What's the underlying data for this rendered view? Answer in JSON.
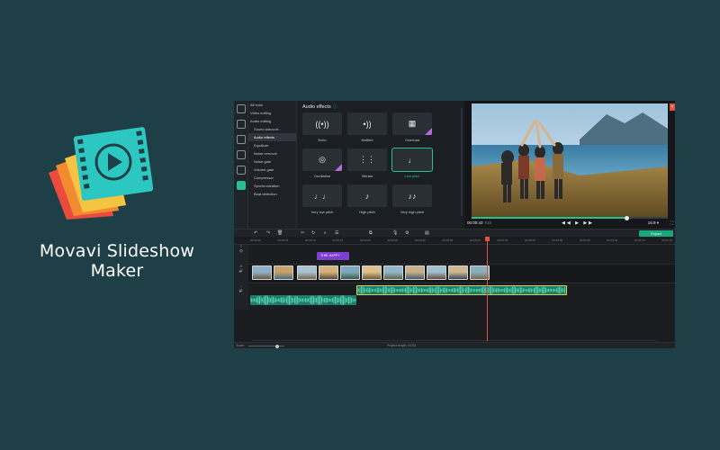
{
  "brand": {
    "title": "Movavi Slideshow Maker",
    "logo_icon": "movavi-slideshow-logo-icon"
  },
  "sidebar_tools": [
    "import-icon",
    "magic-wand-icon",
    "filters-icon",
    "titles-icon",
    "transitions-icon",
    "more-tools-icon"
  ],
  "categories": [
    {
      "label": "All tools",
      "type": "head"
    },
    {
      "label": "Video editing",
      "type": "head"
    },
    {
      "label": "Audio editing",
      "type": "head"
    },
    {
      "label": "Sound autocorr...",
      "type": "item"
    },
    {
      "label": "Audio effects",
      "type": "item",
      "active": true
    },
    {
      "label": "Equalizer",
      "type": "item"
    },
    {
      "label": "Noise removal",
      "type": "item"
    },
    {
      "label": "Noise gate",
      "type": "item"
    },
    {
      "label": "Volume gate",
      "type": "item"
    },
    {
      "label": "Compressor",
      "type": "item"
    },
    {
      "label": "Synchronization",
      "type": "item"
    },
    {
      "label": "Beat detection",
      "type": "item"
    }
  ],
  "effects_panel": {
    "title": "Audio effects",
    "effects": [
      {
        "label": "Echo",
        "icon": "echo-icon",
        "glyph": "((•))",
        "premium": false,
        "selected": false
      },
      {
        "label": "Muffled",
        "icon": "muffled-icon",
        "glyph": "•))",
        "premium": false,
        "selected": false
      },
      {
        "label": "Overload",
        "icon": "overload-icon",
        "glyph": "▦",
        "premium": true,
        "selected": false
      },
      {
        "label": "Oscillation",
        "icon": "oscillation-icon",
        "glyph": "◎",
        "premium": true,
        "selected": false
      },
      {
        "label": "Vibrato",
        "icon": "vibrato-icon",
        "glyph": "⋮⋮",
        "premium": false,
        "selected": false
      },
      {
        "label": "Low pitch",
        "icon": "low-pitch-icon",
        "glyph": "♩",
        "premium": false,
        "selected": true
      },
      {
        "label": "Very low pitch",
        "icon": "very-low-pitch-icon",
        "glyph": "♩♩",
        "premium": false,
        "selected": false
      },
      {
        "label": "High pitch",
        "icon": "high-pitch-icon",
        "glyph": "♪",
        "premium": false,
        "selected": false
      },
      {
        "label": "Very high pitch",
        "icon": "very-high-pitch-icon",
        "glyph": "♪♪",
        "premium": false,
        "selected": false
      }
    ]
  },
  "player": {
    "timecode": "00:00:43",
    "timecode_ms": "915",
    "transport": "◀◀ ▶ ▶▶",
    "aspect_ratio": "16:9 ▾",
    "extra_icons": "⛶",
    "progress": 0.79
  },
  "timeline": {
    "toolbar_icons": [
      "↶",
      "↷",
      "🗑",
      "✂",
      "↻",
      "◐",
      "☰",
      "⧉",
      "🎙",
      "⚙",
      "▤"
    ],
    "ticks": [
      "00:00:00",
      "00:00:05",
      "00:00:10",
      "00:00:15",
      "00:00:20",
      "00:00:25",
      "00:00:30",
      "00:00:35",
      "00:00:40",
      "00:00:45",
      "00:00:50",
      "00:00:55",
      "00:01:00",
      "00:01:05",
      "00:01:10",
      "00:01:15"
    ],
    "export_label": "Export",
    "title_clip_label": "Tt  BE HAPPY",
    "track_controls": {
      "title": "T\n👁",
      "video": "⊟\n🔊",
      "audio": "♪\n🔊"
    },
    "status_label": "Project length: 00:53",
    "status_left": "Scale:"
  },
  "colors": {
    "background": "#1f3f47",
    "accent_green": "#27c08f",
    "premium_purple": "#b46ad8",
    "title_clip": "#7c3fd0",
    "audio_clip": "#1f7c6a",
    "playhead": "#e0533d"
  }
}
